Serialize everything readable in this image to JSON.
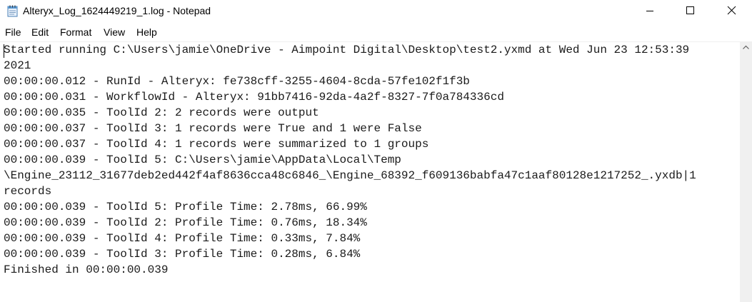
{
  "window": {
    "title": "Alteryx_Log_1624449219_1.log - Notepad",
    "app_icon": "notepad-icon"
  },
  "controls": {
    "minimize_icon": "minimize-icon",
    "maximize_icon": "maximize-icon",
    "close_icon": "close-icon"
  },
  "menu": {
    "file": "File",
    "edit": "Edit",
    "format": "Format",
    "view": "View",
    "help": "Help"
  },
  "editor": {
    "lines": [
      "Started running C:\\Users\\jamie\\OneDrive - Aimpoint Digital\\Desktop\\test2.yxmd at Wed Jun 23 12:53:39",
      "2021",
      "00:00:00.012 - RunId - Alteryx: fe738cff-3255-4604-8cda-57fe102f1f3b",
      "00:00:00.031 - WorkflowId - Alteryx: 91bb7416-92da-4a2f-8327-7f0a784336cd",
      "00:00:00.035 - ToolId 2: 2 records were output",
      "00:00:00.037 - ToolId 3: 1 records were True and 1 were False",
      "00:00:00.037 - ToolId 4: 1 records were summarized to 1 groups",
      "00:00:00.039 - ToolId 5: C:\\Users\\jamie\\AppData\\Local\\Temp",
      "\\Engine_23112_31677deb2ed442f4af8636cca48c6846_\\Engine_68392_f609136babfa47c1aaf80128e1217252_.yxdb|1",
      "records",
      "00:00:00.039 - ToolId 5: Profile Time: 2.78ms, 66.99%",
      "00:00:00.039 - ToolId 2: Profile Time: 0.76ms, 18.34%",
      "00:00:00.039 - ToolId 4: Profile Time: 0.33ms, 7.84%",
      "00:00:00.039 - ToolId 3: Profile Time: 0.28ms, 6.84%",
      "Finished in 00:00:00.039"
    ]
  },
  "scrollbar": {
    "up_icon": "chevron-up-icon"
  }
}
